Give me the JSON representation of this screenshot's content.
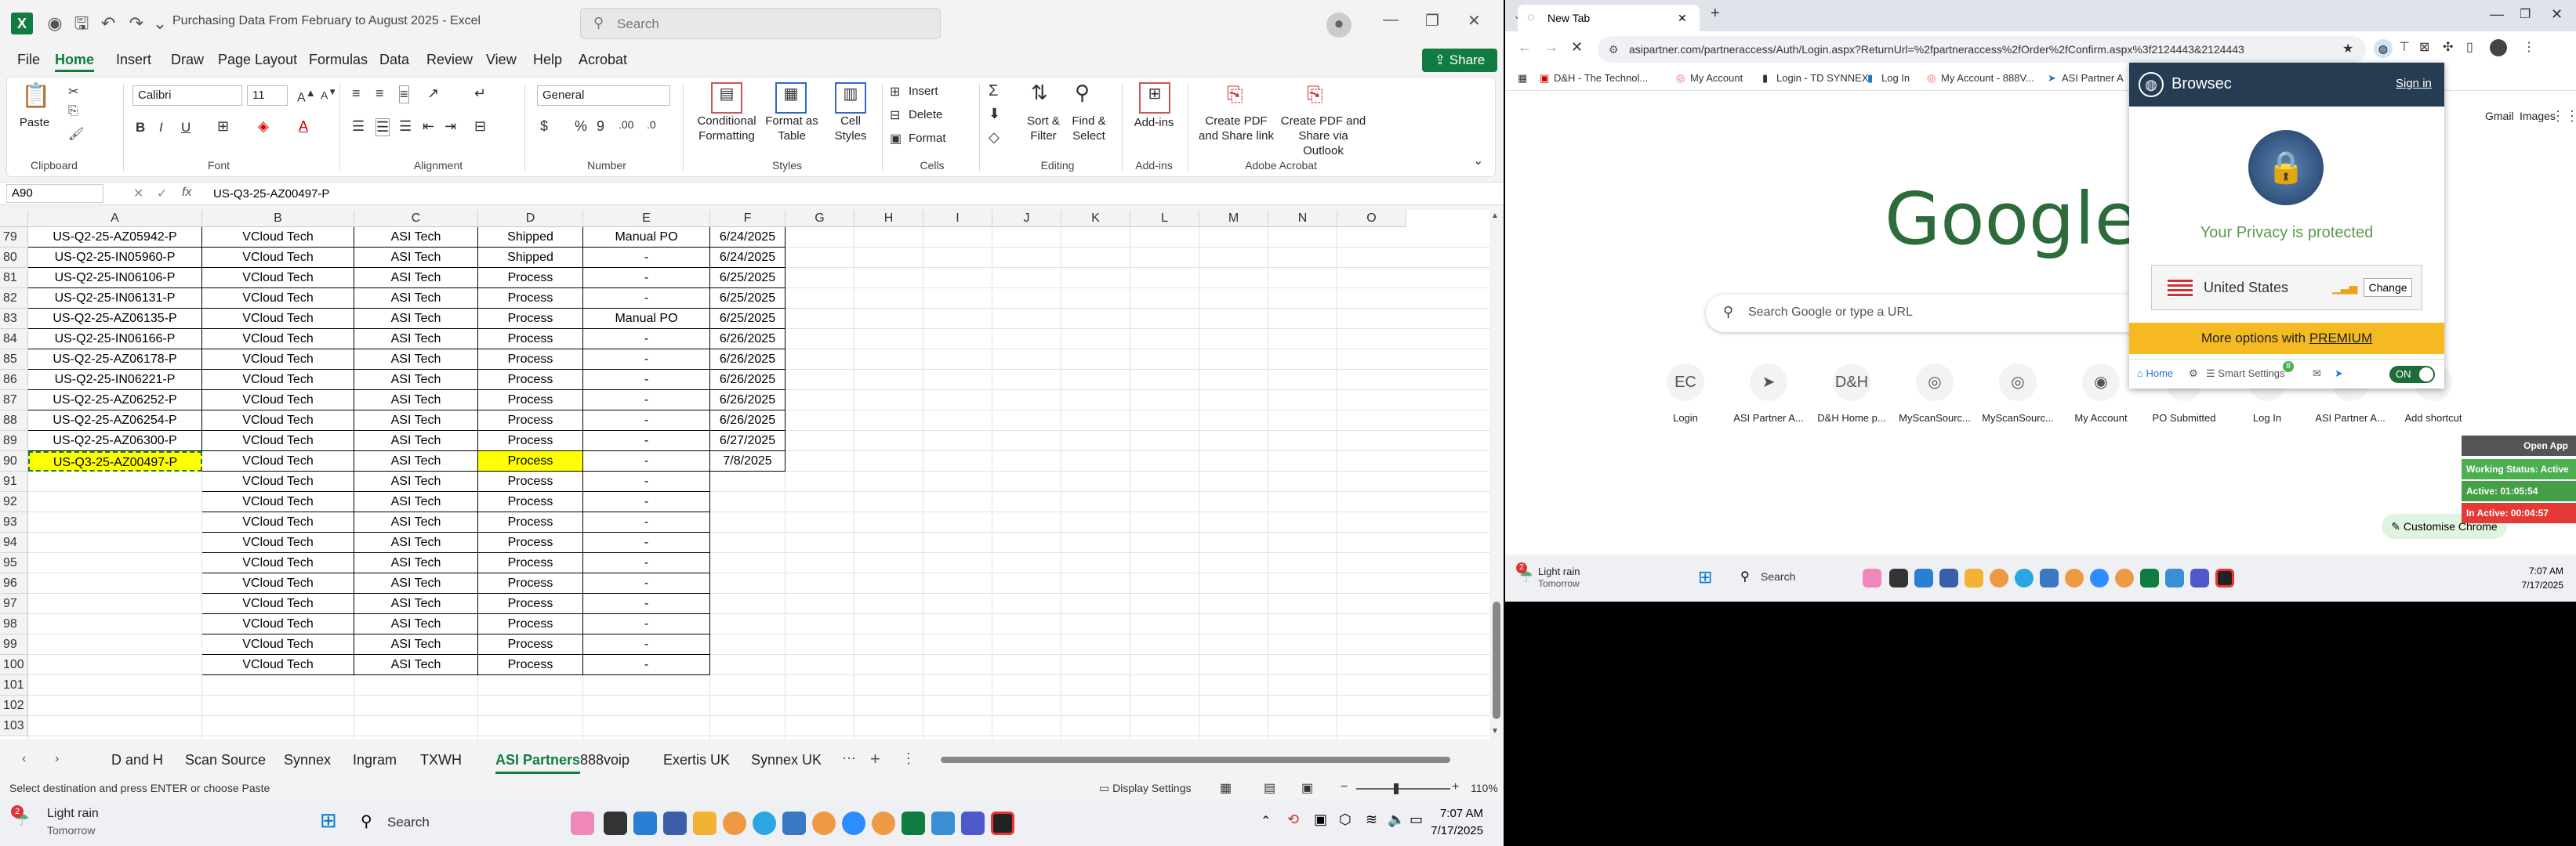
{
  "excel": {
    "title": "Purchasing Data From February to August 2025  -  Excel",
    "search_placeholder": "Search",
    "menu": [
      "File",
      "Home",
      "Insert",
      "Draw",
      "Page Layout",
      "Formulas",
      "Data",
      "Review",
      "View",
      "Help",
      "Acrobat"
    ],
    "share": "Share",
    "ribbon": {
      "paste": "Paste",
      "clipboard": "Clipboard",
      "font_name": "Calibri",
      "font_size": "11",
      "font": "Font",
      "alignment": "Alignment",
      "number_format": "General",
      "number": "Number",
      "cond_fmt": "Conditional Formatting",
      "format_table": "Format as Table",
      "cell_styles": "Cell Styles",
      "styles": "Styles",
      "insert": "Insert",
      "delete": "Delete",
      "format": "Format",
      "cells": "Cells",
      "sort": "Sort & Filter",
      "find": "Find & Select",
      "editing": "Editing",
      "addins": "Add-ins",
      "addins_grp": "Add-ins",
      "pdf_link": "Create PDF and Share link",
      "pdf_outlook": "Create PDF and Share via Outlook",
      "acrobat": "Adobe Acrobat"
    },
    "namebox": "A90",
    "formula": "US-Q3-25-AZ00497-P",
    "fx": "fx",
    "columns": [
      "A",
      "B",
      "C",
      "D",
      "E",
      "F",
      "G",
      "H",
      "I",
      "J",
      "K",
      "L",
      "M",
      "N",
      "O",
      "F"
    ],
    "rows": [
      {
        "n": "79",
        "a": "US-Q2-25-AZ05942-P",
        "b": "VCloud Tech",
        "c": "ASI Tech",
        "d": "Shipped",
        "e": "Manual PO",
        "f": "6/24/2025"
      },
      {
        "n": "80",
        "a": "US-Q2-25-IN05960-P",
        "b": "VCloud Tech",
        "c": "ASI Tech",
        "d": "Shipped",
        "e": "-",
        "f": "6/24/2025"
      },
      {
        "n": "81",
        "a": "US-Q2-25-IN06106-P",
        "b": "VCloud Tech",
        "c": "ASI Tech",
        "d": "Process",
        "e": "-",
        "f": "6/25/2025"
      },
      {
        "n": "82",
        "a": "US-Q2-25-IN06131-P",
        "b": "VCloud Tech",
        "c": "ASI Tech",
        "d": "Process",
        "e": "-",
        "f": "6/25/2025"
      },
      {
        "n": "83",
        "a": "US-Q2-25-AZ06135-P",
        "b": "VCloud Tech",
        "c": "ASI Tech",
        "d": "Process",
        "e": "Manual PO",
        "f": "6/25/2025"
      },
      {
        "n": "84",
        "a": "US-Q2-25-IN06166-P",
        "b": "VCloud Tech",
        "c": "ASI Tech",
        "d": "Process",
        "e": "-",
        "f": "6/26/2025"
      },
      {
        "n": "85",
        "a": "US-Q2-25-AZ06178-P",
        "b": "VCloud Tech",
        "c": "ASI Tech",
        "d": "Process",
        "e": "-",
        "f": "6/26/2025"
      },
      {
        "n": "86",
        "a": "US-Q2-25-IN06221-P",
        "b": "VCloud Tech",
        "c": "ASI Tech",
        "d": "Process",
        "e": "-",
        "f": "6/26/2025"
      },
      {
        "n": "87",
        "a": "US-Q2-25-AZ06252-P",
        "b": "VCloud Tech",
        "c": "ASI Tech",
        "d": "Process",
        "e": "-",
        "f": "6/26/2025"
      },
      {
        "n": "88",
        "a": "US-Q2-25-AZ06254-P",
        "b": "VCloud Tech",
        "c": "ASI Tech",
        "d": "Process",
        "e": "-",
        "f": "6/26/2025"
      },
      {
        "n": "89",
        "a": "US-Q2-25-AZ06300-P",
        "b": "VCloud Tech",
        "c": "ASI Tech",
        "d": "Process",
        "e": "-",
        "f": "6/27/2025"
      },
      {
        "n": "90",
        "a": "US-Q3-25-AZ00497-P",
        "b": "VCloud Tech",
        "c": "ASI Tech",
        "d": "Process",
        "e": "-",
        "f": "7/8/2025"
      },
      {
        "n": "91",
        "a": "",
        "b": "VCloud Tech",
        "c": "ASI Tech",
        "d": "Process",
        "e": "-",
        "f": ""
      },
      {
        "n": "92",
        "a": "",
        "b": "VCloud Tech",
        "c": "ASI Tech",
        "d": "Process",
        "e": "-",
        "f": ""
      },
      {
        "n": "93",
        "a": "",
        "b": "VCloud Tech",
        "c": "ASI Tech",
        "d": "Process",
        "e": "-",
        "f": ""
      },
      {
        "n": "94",
        "a": "",
        "b": "VCloud Tech",
        "c": "ASI Tech",
        "d": "Process",
        "e": "-",
        "f": ""
      },
      {
        "n": "95",
        "a": "",
        "b": "VCloud Tech",
        "c": "ASI Tech",
        "d": "Process",
        "e": "-",
        "f": ""
      },
      {
        "n": "96",
        "a": "",
        "b": "VCloud Tech",
        "c": "ASI Tech",
        "d": "Process",
        "e": "-",
        "f": ""
      },
      {
        "n": "97",
        "a": "",
        "b": "VCloud Tech",
        "c": "ASI Tech",
        "d": "Process",
        "e": "-",
        "f": ""
      },
      {
        "n": "98",
        "a": "",
        "b": "VCloud Tech",
        "c": "ASI Tech",
        "d": "Process",
        "e": "-",
        "f": ""
      },
      {
        "n": "99",
        "a": "",
        "b": "VCloud Tech",
        "c": "ASI Tech",
        "d": "Process",
        "e": "-",
        "f": ""
      },
      {
        "n": "100",
        "a": "",
        "b": "VCloud Tech",
        "c": "ASI Tech",
        "d": "Process",
        "e": "-",
        "f": ""
      },
      {
        "n": "101",
        "a": "",
        "b": "",
        "c": "",
        "d": "",
        "e": "",
        "f": ""
      },
      {
        "n": "102",
        "a": "",
        "b": "",
        "c": "",
        "d": "",
        "e": "",
        "f": ""
      },
      {
        "n": "103",
        "a": "",
        "b": "",
        "c": "",
        "d": "",
        "e": "",
        "f": ""
      }
    ],
    "sheets": [
      "D and H",
      "Scan Source",
      "Synnex",
      "Ingram",
      "TXWH",
      "ASI Partners",
      "888voip",
      "Exertis UK",
      "Synnex UK"
    ],
    "active_sheet": "ASI Partners",
    "status": "Select destination and press ENTER or choose Paste",
    "display_settings": "Display Settings",
    "zoom": "110%"
  },
  "taskbar_left": {
    "weather": "Light rain",
    "weather_sub": "Tomorrow",
    "search": "Search",
    "time": "7:07 AM",
    "date": "7/17/2025",
    "badge": "2"
  },
  "chrome": {
    "tab": "New Tab",
    "url": "asipartner.com/partneraccess/Auth/Login.aspx?ReturnUrl=%2fpartneraccess%2fOrder%2fConfirm.aspx%3f2124443&2124443",
    "bookmarks": [
      "D&H - The Technol...",
      "My Account",
      "Login - TD SYNNEX",
      "Log In",
      "My Account - 888V...",
      "ASI Partner A"
    ],
    "gmail": "Gmail",
    "images": "Images",
    "google": "Google",
    "search_placeholder": "Search Google or type a URL",
    "shortcuts": [
      "Login",
      "ASI Partner A...",
      "D&H Home p...",
      "MyScanSourc...",
      "MyScanSourc...",
      "My Account",
      "PO Submitted",
      "Log In",
      "ASI Partner A...",
      "Add shortcut"
    ],
    "customise": "Customise Chrome",
    "open_app": "Open App",
    "monitor": [
      "Working Status: Active",
      "Active: 01:05:54",
      "In Active: 00:04:57"
    ],
    "colors": {
      "working": "#4caf50",
      "active": "#43a047",
      "inactive": "#e53935"
    }
  },
  "browsec": {
    "brand": "Browsec",
    "signin": "Sign in",
    "privacy": "Your Privacy is protected",
    "country": "United States",
    "change": "Change",
    "more": "More options with ",
    "premium": "PREMIUM",
    "home": "Home",
    "smart": "Smart Settings",
    "badge": "8",
    "on": "ON"
  },
  "taskbar_right": {
    "weather": "Light rain",
    "weather_sub": "Tomorrow",
    "search": "Search",
    "time": "7:07 AM",
    "date": "7/17/2025",
    "badge": "2"
  }
}
